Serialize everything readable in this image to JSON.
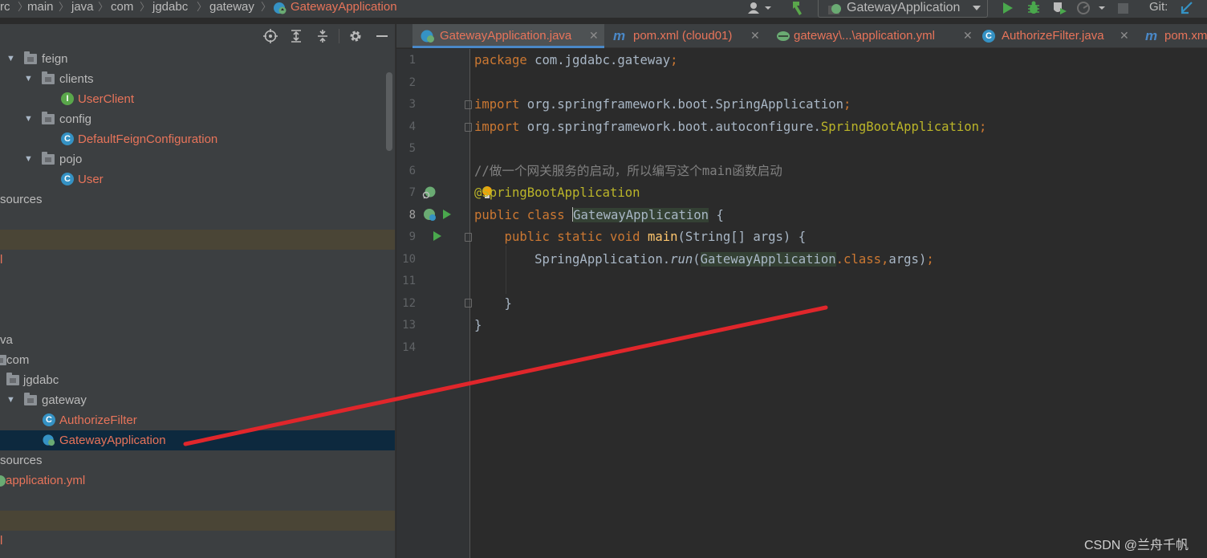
{
  "breadcrumb": {
    "items": [
      "rc",
      "main",
      "java",
      "com",
      "jgdabc",
      "gateway"
    ],
    "active": "GatewayApplication"
  },
  "toolbar": {
    "run_config": "GatewayApplication",
    "git_label": "Git:",
    "icons": [
      "user-dropdown-icon",
      "build-hammer-icon",
      "run-icon",
      "debug-icon",
      "coverage-icon",
      "profile-icon",
      "stop-icon",
      "vcs-update-icon"
    ]
  },
  "project_panel": {
    "toolbar_icons": [
      "locate-icon",
      "expand-all-icon",
      "collapse-all-icon",
      "settings-icon",
      "hide-icon"
    ],
    "tree": [
      {
        "label": "feign",
        "type": "folder",
        "expanded": true
      },
      {
        "label": "clients",
        "type": "folder",
        "expanded": true
      },
      {
        "label": "UserClient",
        "type": "interface"
      },
      {
        "label": "config",
        "type": "folder",
        "expanded": true
      },
      {
        "label": "DefaultFeignConfiguration",
        "type": "class"
      },
      {
        "label": "pojo",
        "type": "folder",
        "expanded": true
      },
      {
        "label": "User",
        "type": "class"
      },
      {
        "label": "sources"
      },
      {
        "label": "l"
      },
      {
        "label": "va"
      },
      {
        "label": "com",
        "type": "folder"
      },
      {
        "label": "jgdabc",
        "type": "folder"
      },
      {
        "label": "gateway",
        "type": "folder",
        "expanded": true
      },
      {
        "label": "AuthorizeFilter",
        "type": "class"
      },
      {
        "label": "GatewayApplication",
        "type": "spring-class",
        "selected": true
      },
      {
        "label": "sources"
      },
      {
        "label": "application.yml",
        "type": "yml"
      },
      {
        "label": "l"
      }
    ]
  },
  "tabs": [
    {
      "label": "GatewayApplication.java",
      "active": true
    },
    {
      "label": "pom.xml (cloud01)"
    },
    {
      "label": "gateway\\...\\application.yml"
    },
    {
      "label": "AuthorizeFilter.java"
    },
    {
      "label": "pom.xm"
    }
  ],
  "editor": {
    "current_line": 8,
    "lines": [
      {
        "n": "1",
        "tokens": [
          [
            "kw",
            "package"
          ],
          [
            "",
            " com.jgdabc.gateway"
          ],
          [
            "kw",
            ";"
          ]
        ]
      },
      {
        "n": "2",
        "tokens": []
      },
      {
        "n": "3",
        "tokens": [
          [
            "kw",
            "import"
          ],
          [
            "",
            " org.springframework.boot.SpringApplication"
          ],
          [
            "kw",
            ";"
          ]
        ]
      },
      {
        "n": "4",
        "tokens": [
          [
            "kw",
            "import"
          ],
          [
            "",
            " org.springframework.boot.autoconfigure."
          ],
          [
            "ann",
            "SpringBootApplication"
          ],
          [
            "kw",
            ";"
          ]
        ]
      },
      {
        "n": "5",
        "tokens": []
      },
      {
        "n": "6",
        "tokens": [
          [
            "cmt",
            "//做一个网关服务的启动，所以编写这个main函数启动"
          ]
        ]
      },
      {
        "n": "7",
        "tokens": [
          [
            "ann",
            "@SpringBootApplication"
          ]
        ]
      },
      {
        "n": "8",
        "tokens": [
          [
            "kw",
            "public class "
          ],
          [
            "caret",
            ""
          ],
          [
            "hlref",
            "GatewayApplication"
          ],
          [
            "",
            " {"
          ]
        ]
      },
      {
        "n": "9",
        "tokens": [
          [
            "",
            " "
          ],
          [
            "kw",
            "   public static void "
          ],
          [
            "fn",
            "main"
          ],
          [
            "",
            "(String[] args) {"
          ]
        ]
      },
      {
        "n": "10",
        "tokens": [
          [
            "",
            "        SpringApplication."
          ],
          [
            "ital",
            "run"
          ],
          [
            "",
            "("
          ],
          [
            "hlref",
            "GatewayApplication"
          ],
          [
            "kw",
            ".class,"
          ],
          [
            "",
            "args)"
          ],
          [
            "kw",
            ";"
          ]
        ]
      },
      {
        "n": "11",
        "tokens": []
      },
      {
        "n": "12",
        "tokens": [
          [
            "",
            "    }"
          ]
        ]
      },
      {
        "n": "13",
        "tokens": [
          [
            "",
            "}"
          ]
        ]
      },
      {
        "n": "14",
        "tokens": []
      }
    ]
  },
  "watermark": "CSDN @兰舟千帆",
  "colors": {
    "annotation_line": "#e0262b",
    "accent": "#4a88c7",
    "error_text": "#e8745a"
  }
}
